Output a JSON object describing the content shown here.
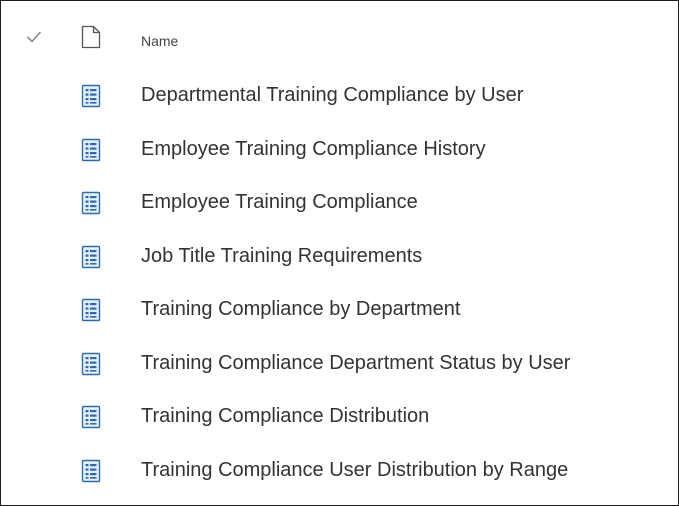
{
  "header": {
    "name_label": "Name",
    "select_icon": "checkmark-icon",
    "type_icon": "document-icon"
  },
  "items": [
    {
      "name": "Departmental Training Compliance by User",
      "icon": "report-file-icon"
    },
    {
      "name": "Employee Training Compliance History",
      "icon": "report-file-icon"
    },
    {
      "name": "Employee Training Compliance",
      "icon": "report-file-icon"
    },
    {
      "name": "Job Title Training Requirements",
      "icon": "report-file-icon"
    },
    {
      "name": "Training Compliance by Department",
      "icon": "report-file-icon"
    },
    {
      "name": "Training Compliance Department Status by User",
      "icon": "report-file-icon"
    },
    {
      "name": "Training Compliance Distribution",
      "icon": "report-file-icon"
    },
    {
      "name": "Training Compliance User Distribution by Range",
      "icon": "report-file-icon"
    }
  ],
  "colors": {
    "icon_blue": "#2b6cb0",
    "icon_fill": "#e8f1fb",
    "text": "#333333",
    "header_text": "#444444"
  }
}
